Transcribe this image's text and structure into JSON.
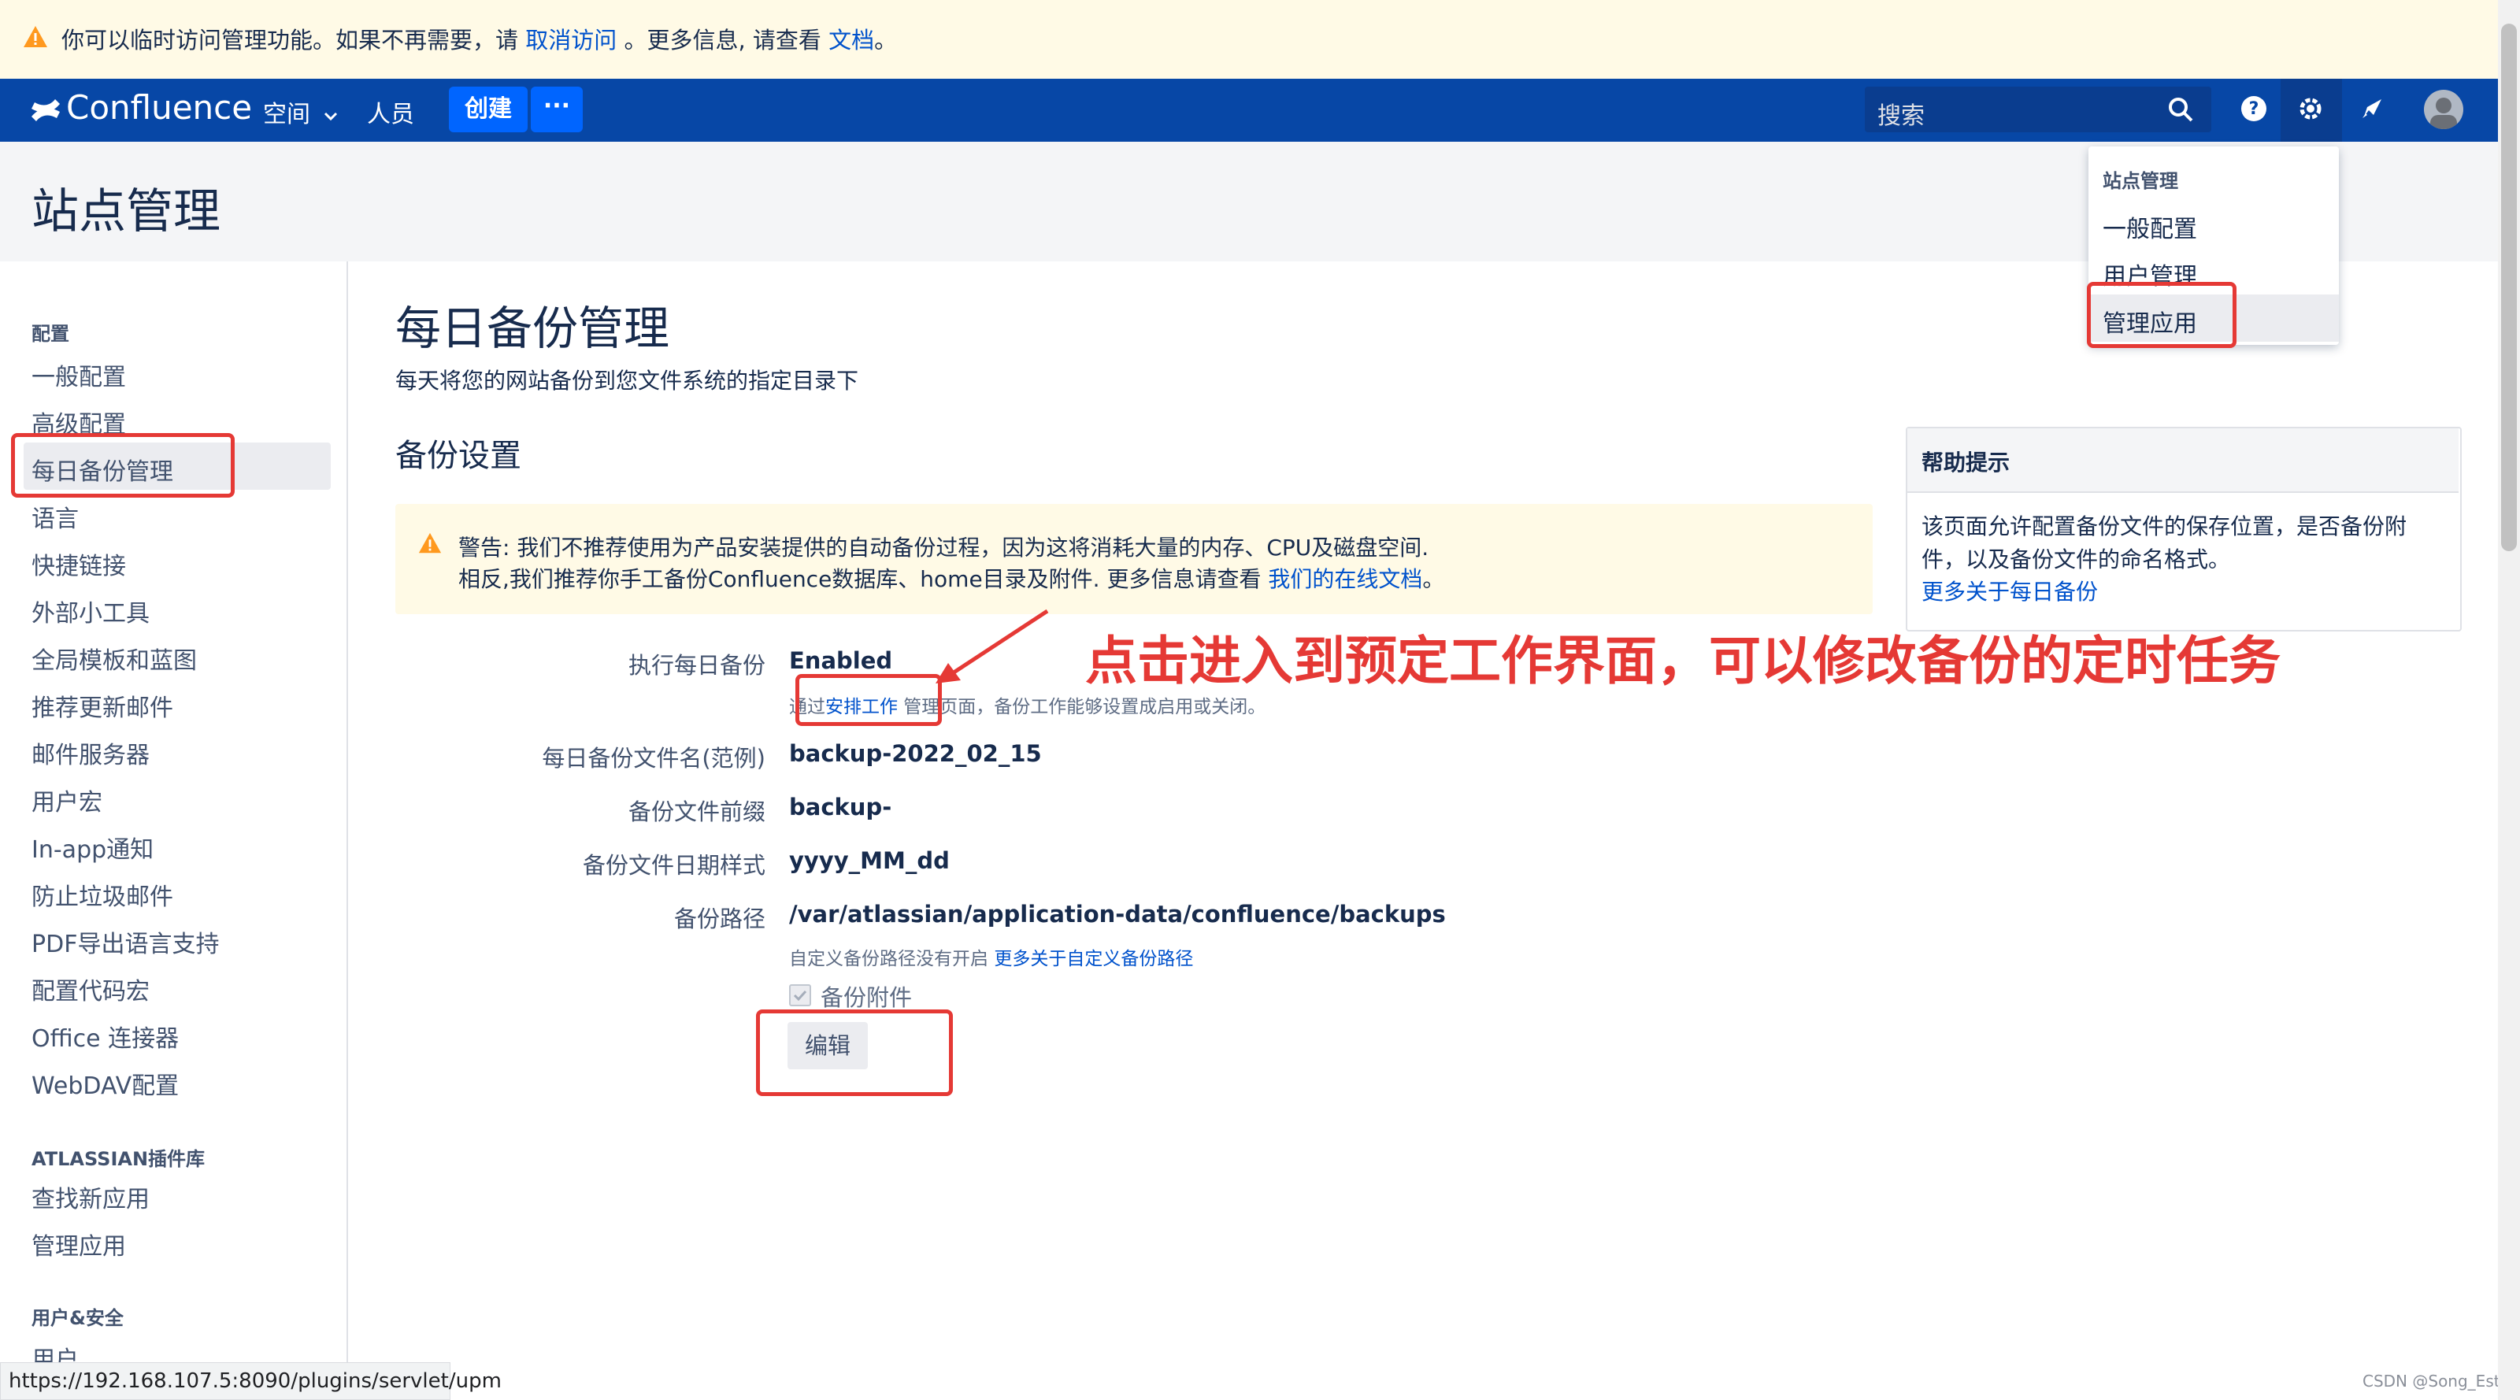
{
  "banner": {
    "text_before": "你可以临时访问管理功能。如果不再需要，请 ",
    "revoke_link": "取消访问",
    "text_mid": " 。更多信息, 请查看 ",
    "docs_link": "文档",
    "text_after": "。"
  },
  "header": {
    "logo": "Confluence",
    "spaces": "空间",
    "people": "人员",
    "create": "创建",
    "more": "···",
    "search_placeholder": "搜索"
  },
  "page_title": "站点管理",
  "dropdown": {
    "heading": "站点管理",
    "items": [
      "一般配置",
      "用户管理",
      "管理应用"
    ]
  },
  "sidebar": {
    "sections": [
      {
        "heading": "配置",
        "items": [
          "一般配置",
          "高级配置",
          "每日备份管理",
          "语言",
          "快捷链接",
          "外部小工具",
          "全局模板和蓝图",
          "推荐更新邮件",
          "邮件服务器",
          "用户宏",
          "In-app通知",
          "防止垃圾邮件",
          "PDF导出语言支持",
          "配置代码宏",
          "Office 连接器",
          "WebDAV配置"
        ]
      },
      {
        "heading": "ATLASSIAN插件库",
        "items": [
          "查找新应用",
          "管理应用"
        ]
      },
      {
        "heading": "用户&安全",
        "items": [
          "用户"
        ]
      }
    ]
  },
  "main": {
    "title": "每日备份管理",
    "subtitle": "每天将您的网站备份到您文件系统的指定目录下",
    "section_title": "备份设置",
    "warning_line1": "警告: 我们不推荐使用为产品安装提供的自动备份过程，因为这将消耗大量的内存、CPU及磁盘空间.",
    "warning_line2_prefix": "相反,我们推荐你手工备份Confluence数据库、home目录及附件. 更多信息请查看 ",
    "warning_link": "我们的在线文档",
    "warning_line2_suffix": "。",
    "fields": {
      "daily_backup_label": "执行每日备份",
      "daily_backup_value": "Enabled",
      "daily_backup_note_prefix": "通过",
      "daily_backup_note_link": "安排工作",
      "daily_backup_note_suffix": " 管理页面，备份工作能够设置成启用或关闭。",
      "filename_label": "每日备份文件名(范例)",
      "filename_value": "backup-2022_02_15",
      "prefix_label": "备份文件前缀",
      "prefix_value": "backup-",
      "date_pattern_label": "备份文件日期样式",
      "date_pattern_value": "yyyy_MM_dd",
      "path_label": "备份路径",
      "path_value": "/var/atlassian/application-data/confluence/backups",
      "path_note_prefix": "自定义备份路径没有开启 ",
      "path_note_link": "更多关于自定义备份路径",
      "attachments_label": "备份附件",
      "edit_button": "编辑"
    }
  },
  "help": {
    "title": "帮助提示",
    "body": "该页面允许配置备份文件的保存位置，是否备份附件，以及备份文件的命名格式。",
    "link": "更多关于每日备份"
  },
  "annotation": "点击进入到预定工作界面，可以修改备份的定时任务",
  "status_bar": "https://192.168.107.5:8090/plugins/servlet/upm",
  "watermark": "CSDN @Song_Estell"
}
